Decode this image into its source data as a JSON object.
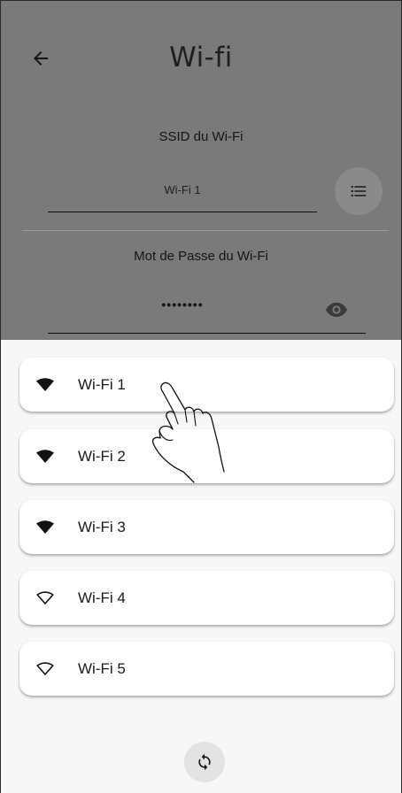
{
  "header": {
    "title": "Wi-fi",
    "back_icon": "arrow-left-icon"
  },
  "ssid": {
    "label": "SSID du Wi-Fi",
    "value": "Wi-Fi 1",
    "list_icon": "list-icon"
  },
  "password": {
    "label": "Mot de Passe du Wi-Fi",
    "value": "••••••••",
    "visibility_icon": "eye-icon"
  },
  "networks": [
    {
      "name": "Wi-Fi 1",
      "signal": "full"
    },
    {
      "name": "Wi-Fi 2",
      "signal": "full"
    },
    {
      "name": "Wi-Fi 3",
      "signal": "full"
    },
    {
      "name": "Wi-Fi 4",
      "signal": "empty"
    },
    {
      "name": "Wi-Fi 5",
      "signal": "empty"
    }
  ],
  "refresh_icon": "refresh-icon",
  "colors": {
    "dim_overlay": "#7a7a7a",
    "sheet_bg": "#f7f7f7",
    "card_bg": "#ffffff"
  }
}
